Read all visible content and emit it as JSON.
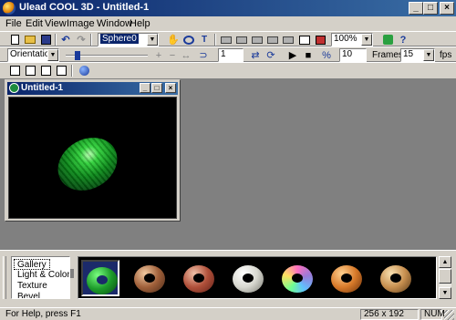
{
  "window": {
    "title": "Ulead COOL 3D - Untitled-1"
  },
  "menu": [
    "File",
    "Edit",
    "View",
    "Image",
    "Window",
    "Help"
  ],
  "toolbar1": {
    "object_combo": "Sphere0",
    "zoom_combo": "100%",
    "icons": [
      "new-icon",
      "open-icon",
      "save-icon",
      "undo-icon",
      "redo-icon",
      "pan-icon",
      "rotate-icon",
      "text-icon",
      "view-icon",
      "view-icon",
      "view-icon",
      "view-icon",
      "view-icon",
      "render-icon",
      "export-icon",
      "object-icon",
      "help-icon"
    ]
  },
  "toolbar2": {
    "attribute_combo": "Orientation",
    "frame_value": "1",
    "frames_label": "Frames",
    "frames_value": "10",
    "fps_value": "15",
    "fps_label": "fps"
  },
  "document": {
    "title": "Untitled-1",
    "object_color": "#1fb82c"
  },
  "gallery": {
    "categories": [
      "Gallery",
      "Light & Color",
      "Texture",
      "Bevel"
    ],
    "selected": "Gallery",
    "thumbnails": [
      {
        "name": "green-marble",
        "color": "#1c9b2a"
      },
      {
        "name": "brown-stone",
        "color": "#a0603a"
      },
      {
        "name": "red-granite",
        "color": "#b0503a"
      },
      {
        "name": "white-marble",
        "color": "#d8d8d0"
      },
      {
        "name": "rainbow",
        "color": "#9a7ad8"
      },
      {
        "name": "orange-wood",
        "color": "#d87a2a"
      },
      {
        "name": "gold-rock",
        "color": "#c89050"
      }
    ]
  },
  "status": {
    "help": "For Help, press F1",
    "size": "256 x 192",
    "num": "NUM"
  }
}
